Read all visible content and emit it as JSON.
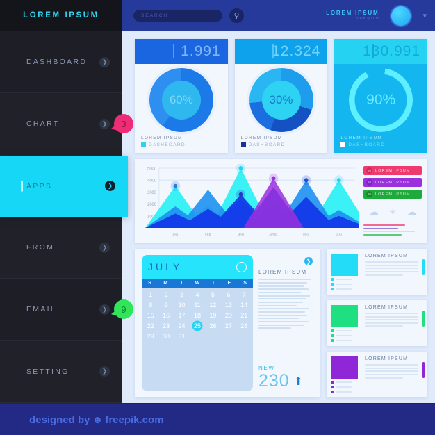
{
  "sidebar": {
    "brand": "LOREM IPSUM",
    "items": [
      {
        "label": "DASHBOARD",
        "active": false,
        "badge": null
      },
      {
        "label": "CHART",
        "active": false,
        "badge": "3",
        "badge_color": "#ef2d77"
      },
      {
        "label": "APPS",
        "active": true,
        "badge": null
      },
      {
        "label": "FROM",
        "active": false,
        "badge": null
      },
      {
        "label": "EMAIL",
        "active": false,
        "badge": "9",
        "badge_color": "#2fe558"
      },
      {
        "label": "SETTING",
        "active": false,
        "badge": null
      }
    ]
  },
  "topbar": {
    "search_placeholder": "SEARCH",
    "search_value": "",
    "user_name": "LOREM IPSUM",
    "user_sub": "Lorem Ipsum"
  },
  "kpi_cards": [
    {
      "value": "1.991",
      "percent": "60%",
      "label": "LOREM IPSUM",
      "sublabel": "DASHBOARD",
      "swatch": "#2fd0f2"
    },
    {
      "value": "12.324",
      "percent": "30%",
      "label": "LOREM IPSUM",
      "sublabel": "DASHBOARD",
      "swatch": "#16309c"
    },
    {
      "value": "130.991",
      "percent": "90%",
      "label": "LOREM IPSUM",
      "sublabel": "DASHBOARD",
      "swatch": "#ffffff"
    }
  ],
  "legend": [
    {
      "num": "20",
      "label": "LOREM IPSUM",
      "color": "#ef3a6e"
    },
    {
      "num": "60",
      "label": "LOREM IPSUM",
      "color": "#9b30dd"
    },
    {
      "num": "30",
      "label": "LOREM IPSUM",
      "color": "#1faa3c"
    }
  ],
  "weather_icons": [
    "cloud-icon",
    "sun-icon",
    "cloud-icon"
  ],
  "calendar": {
    "month": "JULY",
    "dow": [
      "S",
      "M",
      "T",
      "W",
      "T",
      "F",
      "S"
    ],
    "days": [
      1,
      2,
      3,
      4,
      5,
      6,
      7,
      8,
      9,
      10,
      11,
      12,
      13,
      14,
      15,
      16,
      17,
      18,
      19,
      20,
      21,
      22,
      23,
      24,
      25,
      26,
      27,
      28,
      29,
      30,
      31
    ],
    "selected": 25
  },
  "cal_side": {
    "title": "LOREM IPSUM",
    "new_label": "NEW",
    "new_value": "230"
  },
  "mini_cards": [
    {
      "title": "LOREM IPSUM",
      "color": "#22dcf8",
      "legend": [
        "LOREM IPSUM",
        "LOREM IPSUM",
        "LOREM IPSUM"
      ]
    },
    {
      "title": "LOREM IPSUM",
      "color": "#1fe081",
      "legend": [
        "LOREM IPSUM",
        "LOREM IPSUM",
        "LOREM IPSUM"
      ]
    },
    {
      "title": "LOREM IPSUM",
      "color": "#8f26d8",
      "legend": [
        "LOREM IPSUM",
        "LOREM IPSUM",
        "LOREM IPSUM"
      ]
    }
  ],
  "footer": {
    "text_before": "designed by",
    "text_after": "freepik.com"
  },
  "chart_data": {
    "type": "area",
    "title": "",
    "xlabel": "",
    "ylabel": "",
    "categories": [
      "JAN",
      "FEB",
      "MAR",
      "APRIL",
      "MAY",
      "JUN"
    ],
    "ylim": [
      0,
      5000
    ],
    "yticks": [
      1000,
      2000,
      3000,
      4000,
      5000
    ],
    "grid": true,
    "series": [
      {
        "name": "cyan-peaks",
        "color": "#2ff0f5",
        "values": [
          3500,
          1800,
          5000,
          2200,
          2500,
          4000
        ]
      },
      {
        "name": "blue-peaks",
        "color": "#1e90f0",
        "values": [
          1800,
          3200,
          2400,
          2000,
          4000,
          1500
        ]
      },
      {
        "name": "deep-blue-peaks",
        "color": "#1336e8",
        "values": [
          1200,
          1600,
          2800,
          3400,
          2600,
          1000
        ]
      },
      {
        "name": "purple-peak",
        "color": "#9b30dd",
        "values": [
          null,
          null,
          null,
          4150,
          null,
          null
        ]
      }
    ],
    "markers": [
      {
        "x": "JAN",
        "y": 3500,
        "color": "#2a7de0"
      },
      {
        "x": "MAR",
        "y": 5000,
        "color": "#2ad2f2"
      },
      {
        "x": "MAR",
        "y": 2800,
        "color": "#2438c8"
      },
      {
        "x": "APRIL",
        "y": 4150,
        "color": "#9b30dd"
      },
      {
        "x": "MAY",
        "y": 4000,
        "color": "#1d4fd8"
      },
      {
        "x": "JUN",
        "y": 4000,
        "color": "#2ad2f2"
      }
    ]
  }
}
